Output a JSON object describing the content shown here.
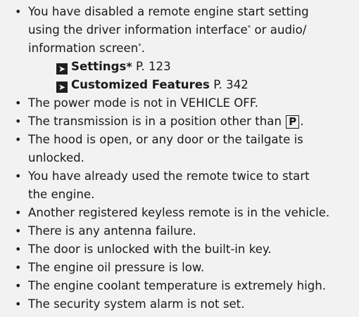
{
  "conditions": {
    "items": [
      {
        "lines": [
          "You have disabled a remote engine start setting",
          "using the driver information interface",
          "or audio/",
          "information screen"
        ],
        "mark": "*"
      },
      {
        "text": "The power mode is not in VEHICLE OFF."
      },
      {
        "before": "The transmission is in a position other than ",
        "key": "P",
        "after": "."
      },
      {
        "lines": [
          "The hood is open, or any door or the tailgate is",
          "unlocked."
        ]
      },
      {
        "lines": [
          "You have already used the remote twice to start",
          "the engine."
        ]
      },
      {
        "text": "Another registered keyless remote is in the vehicle."
      },
      {
        "text": "There is any antenna failure."
      },
      {
        "text": "The door is unlocked with the built-in key."
      },
      {
        "text": "The engine oil pressure is low."
      },
      {
        "text": "The engine coolant temperature is extremely high."
      },
      {
        "text": "The security system alarm is not set."
      }
    ],
    "refs": [
      {
        "title": "Settings",
        "mark": "*",
        "page": "P. 123",
        "arrow_icon": "right-arrow-box-icon"
      },
      {
        "title": "Customized Features",
        "page": "P. 342",
        "arrow_icon": "right-arrow-box-icon"
      }
    ],
    "bullet": "•"
  }
}
